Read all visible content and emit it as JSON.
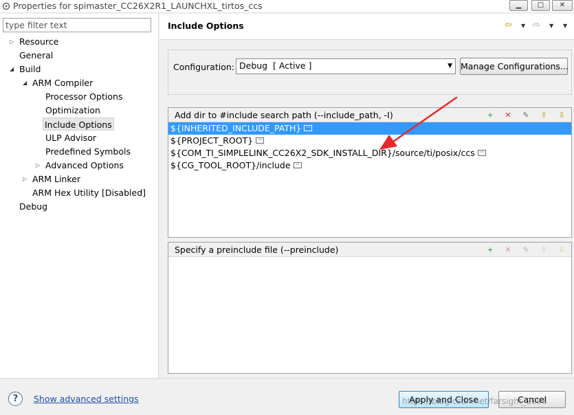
{
  "window": {
    "title": "Properties for spimaster_CC26X2R1_LAUNCHXL_tirtos_ccs",
    "min_glyph": "▁",
    "max_glyph": "□",
    "close_glyph": "✕"
  },
  "filter": {
    "placeholder": "type filter text"
  },
  "tree": {
    "resource": "Resource",
    "general": "General",
    "build": "Build",
    "arm_compiler": "ARM Compiler",
    "processor_options": "Processor Options",
    "optimization": "Optimization",
    "include_options": "Include Options",
    "ulp_advisor": "ULP Advisor",
    "predefined_symbols": "Predefined Symbols",
    "advanced_options": "Advanced Options",
    "arm_linker": "ARM Linker",
    "arm_hex_utility": "ARM Hex Utility  [Disabled]",
    "debug": "Debug"
  },
  "page": {
    "title": "Include Options",
    "nav": {
      "back": "⇦",
      "forward": "⇨",
      "dropdown": "▼",
      "menu": "▼"
    }
  },
  "config": {
    "label": "Configuration:",
    "selected": "Debug  [ Active ]",
    "manage_label": "Manage Configurations..."
  },
  "include_list": {
    "header": "Add dir to #include search path (--include_path, -I)",
    "items": [
      "${INHERITED_INCLUDE_PATH}",
      "${PROJECT_ROOT}",
      "${COM_TI_SIMPLELINK_CC26X2_SDK_INSTALL_DIR}/source/ti/posix/ccs",
      "${CG_TOOL_ROOT}/include"
    ],
    "selected_index": 0
  },
  "preinclude_list": {
    "header": "Specify a preinclude file (--preinclude)"
  },
  "tools": {
    "add": "+",
    "delete": "✕",
    "edit": "✎",
    "up": "⇧",
    "down": "⇩",
    "ellipsis": "···"
  },
  "footer": {
    "help_glyph": "?",
    "advanced_link": "Show advanced settings",
    "apply_label": "Apply and Close",
    "cancel_label": "Cancel",
    "watermark": "https://blog.csdn.net/farsight_2098"
  },
  "colors": {
    "selection": "#3399ff",
    "annotation_arrow": "#e8262b",
    "link": "#1a4ea8"
  }
}
